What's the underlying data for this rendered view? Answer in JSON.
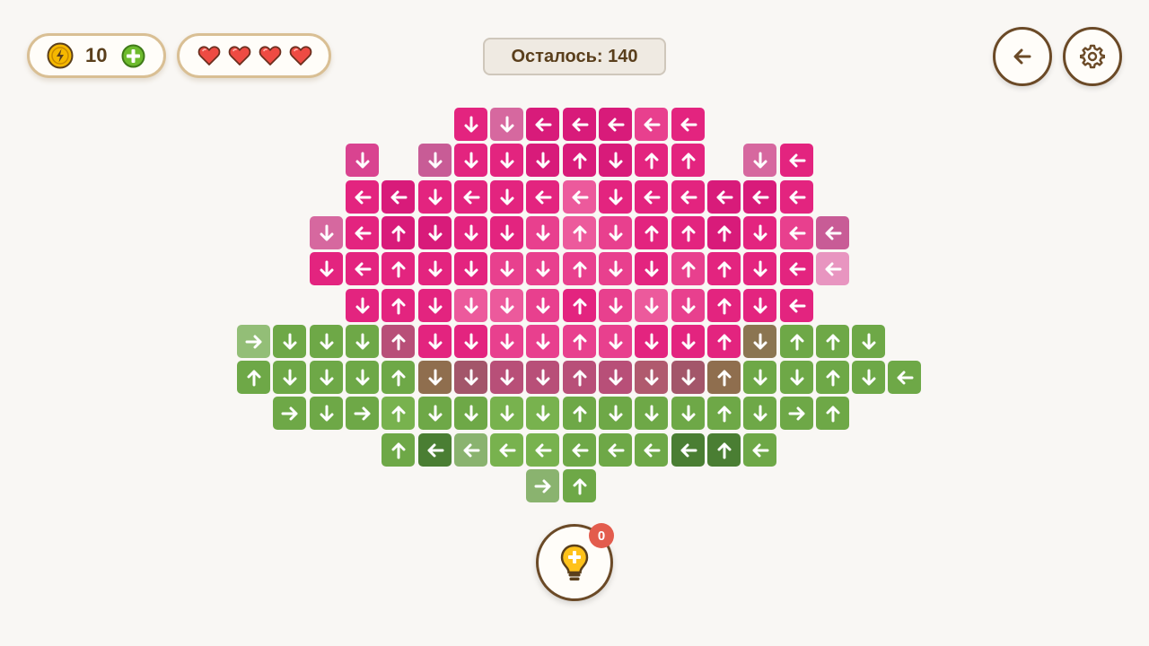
{
  "hud": {
    "coins": "10",
    "hearts_count": 4,
    "remaining_label": "Осталось: 140"
  },
  "hint": {
    "count": "0"
  },
  "icons": {
    "coin": "coin-icon",
    "add": "plus-icon",
    "heart": "heart-icon",
    "back": "arrow-left-icon",
    "settings": "gear-icon",
    "hint": "lightbulb-icon"
  },
  "colors": {
    "pink_a": "#e3247f",
    "pink_b": "#e8408e",
    "pink_c": "#d81b7a",
    "pink_d": "#ec5a9c",
    "pink_e": "#d6689f",
    "pink_f": "#c85c96",
    "pink_g": "#e895c0",
    "pink_h": "#d94390",
    "mauve_a": "#b84f78",
    "mauve_b": "#b05a6e",
    "mauve_c": "#a3566a",
    "olive_a": "#8f6e4e",
    "olive_b": "#8b7551",
    "green_a": "#6ea847",
    "green_b": "#78b24e",
    "green_c": "#93be77",
    "green_d": "#8ab36f",
    "green_e": "#4a7e33",
    "green_f": "#5b923d",
    "brown": "#6b4a27"
  },
  "grid": {
    "rows": [
      {
        "row": 0,
        "start": 6,
        "cells": [
          "D:pink_a",
          "D:pink_e",
          "L:pink_c",
          "L:pink_c",
          "L:pink_c",
          "L:pink_b",
          "L:pink_a"
        ]
      },
      {
        "row": 1,
        "start": 3,
        "cells": [
          "D:pink_h",
          "_",
          "D:pink_f",
          "D:pink_a",
          "D:pink_a",
          "D:pink_c",
          "U:pink_c",
          "D:pink_c",
          "U:pink_a",
          "U:pink_a",
          "_",
          "D:pink_e",
          "L:pink_a"
        ]
      },
      {
        "row": 2,
        "start": 3,
        "cells": [
          "L:pink_a",
          "L:pink_c",
          "D:pink_a",
          "L:pink_a",
          "D:pink_a",
          "L:pink_a",
          "L:pink_d",
          "D:pink_a",
          "L:pink_a",
          "L:pink_a",
          "L:pink_c",
          "L:pink_c",
          "L:pink_a"
        ]
      },
      {
        "row": 3,
        "start": 2,
        "cells": [
          "D:pink_e",
          "L:pink_a",
          "U:pink_c",
          "D:pink_c",
          "D:pink_a",
          "D:pink_a",
          "D:pink_b",
          "U:pink_d",
          "D:pink_b",
          "U:pink_a",
          "U:pink_a",
          "U:pink_c",
          "D:pink_a",
          "L:pink_b",
          "L:pink_f"
        ]
      },
      {
        "row": 4,
        "start": 2,
        "cells": [
          "D:pink_a",
          "L:pink_a",
          "U:pink_a",
          "D:pink_a",
          "D:pink_a",
          "D:pink_b",
          "D:pink_b",
          "U:pink_b",
          "D:pink_b",
          "D:pink_a",
          "U:pink_b",
          "U:pink_a",
          "D:pink_a",
          "L:pink_a",
          "L:pink_g"
        ]
      },
      {
        "row": 5,
        "start": 3,
        "cells": [
          "D:pink_a",
          "U:pink_a",
          "D:pink_a",
          "D:pink_d",
          "D:pink_d",
          "D:pink_b",
          "U:pink_a",
          "D:pink_b",
          "D:pink_d",
          "D:pink_b",
          "U:pink_a",
          "D:pink_a",
          "L:pink_a"
        ]
      },
      {
        "row": 6,
        "start": 0,
        "cells": [
          "R:green_c",
          "D:green_a",
          "D:green_a",
          "D:green_a",
          "U:mauve_a",
          "D:pink_a",
          "D:pink_a",
          "D:pink_b",
          "D:pink_b",
          "U:pink_b",
          "D:pink_b",
          "D:pink_a",
          "D:pink_a",
          "U:pink_a",
          "D:olive_b",
          "U:green_a",
          "U:green_a",
          "D:green_a"
        ]
      },
      {
        "row": 7,
        "start": 0,
        "cells": [
          "U:green_a",
          "D:green_a",
          "D:green_a",
          "D:green_a",
          "U:green_a",
          "D:olive_a",
          "D:mauve_c",
          "D:mauve_a",
          "D:mauve_a",
          "U:mauve_a",
          "D:mauve_a",
          "D:mauve_b",
          "D:mauve_c",
          "U:olive_a",
          "D:green_a",
          "D:green_a",
          "U:green_a",
          "D:green_a",
          "L:green_a"
        ]
      },
      {
        "row": 8,
        "start": 1,
        "cells": [
          "R:green_a",
          "D:green_a",
          "R:green_a",
          "U:green_b",
          "D:green_a",
          "D:green_a",
          "D:green_b",
          "D:green_b",
          "U:green_a",
          "D:green_a",
          "D:green_a",
          "D:green_a",
          "U:green_a",
          "D:green_a",
          "R:green_a",
          "U:green_a"
        ]
      },
      {
        "row": 9,
        "start": 4,
        "cells": [
          "U:green_a",
          "L:green_e",
          "L:green_d",
          "L:green_b",
          "L:green_b",
          "L:green_a",
          "L:green_a",
          "L:green_a",
          "L:green_e",
          "U:green_e",
          "L:green_a"
        ]
      },
      {
        "row": 10,
        "start": 8,
        "cells": [
          "R:green_d",
          "U:green_a"
        ]
      }
    ]
  }
}
